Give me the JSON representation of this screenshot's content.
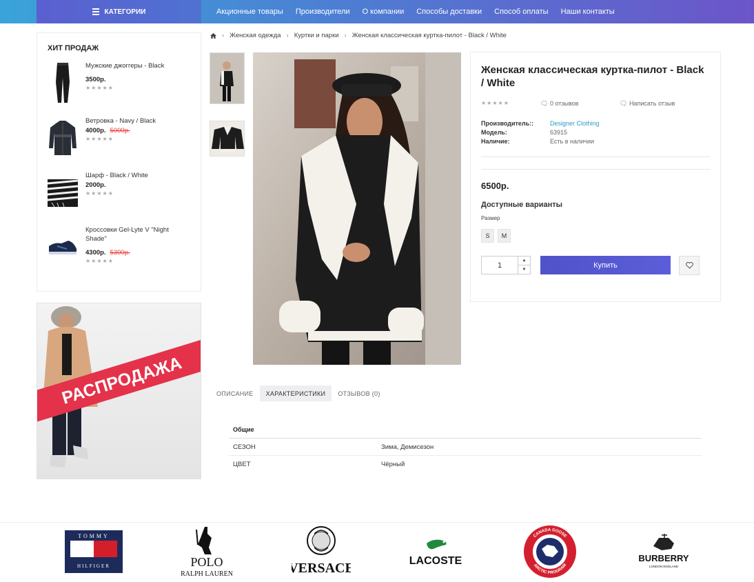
{
  "header": {
    "categories_label": "КАТЕГОРИИ",
    "menu": [
      "Акционные товары",
      "Производители",
      "О компании",
      "Способы доставки",
      "Способ оплаты",
      "Наши контакты"
    ]
  },
  "sidebar": {
    "hits_title": "ХИТ ПРОДАЖ",
    "items": [
      {
        "name": "Мужские джоггеры - Black",
        "price": "3500р.",
        "old_price": ""
      },
      {
        "name": "Ветровка - Navy / Black",
        "price": "4000р.",
        "old_price": "5000р."
      },
      {
        "name": "Шарф - Black / White",
        "price": "2000р.",
        "old_price": ""
      },
      {
        "name": "Кроссовки Gel-Lyte V \"Night Shade\"",
        "price": "4300р.",
        "old_price": "5300р."
      }
    ],
    "sale_banner_text": "РАСПРОДАЖА"
  },
  "breadcrumb": [
    "Женская одежда",
    "Куртки и парки",
    "Женская классическая куртка-пилот - Black / White"
  ],
  "product": {
    "title": "Женская классическая куртка-пилот - Black / White",
    "reviews_link": "0 отзывов",
    "write_review": "Написать отзыв",
    "manufacturer_label": "Производитель::",
    "manufacturer": "Designer Clothing",
    "model_label": "Модель:",
    "model": "63915",
    "availability_label": "Наличие:",
    "availability": "Есть в наличии",
    "price": "6500р.",
    "variants_title": "Доступные варианты",
    "size_label": "Размер",
    "sizes": [
      "S",
      "M"
    ],
    "quantity": "1",
    "buy_label": "Купить"
  },
  "tabs": [
    "ОПИСАНИЕ",
    "ХАРАКТЕРИСТИКИ",
    "ОТЗЫВОВ (0)"
  ],
  "attributes": {
    "group": "Общие",
    "rows": [
      {
        "name": "СЕЗОН",
        "value": "Зима, Демисезон"
      },
      {
        "name": "ЦВЕТ",
        "value": "Чёрный"
      }
    ]
  },
  "brands": {
    "tommy_line1": "TOMMY",
    "tommy_line2": "HILFIGER",
    "polo_line1": "POLO",
    "polo_line2": "RALPH LAUREN",
    "versace": "VERSACE",
    "lacoste": "LACOSTE",
    "canada_goose_ring_top": "CANADA GOOSE",
    "canada_goose_ring_bottom": "ARCTIC PROGRAM",
    "burberry": "BURBERRY",
    "burberry_sub": "LONDON ENGLAND"
  },
  "colors": {
    "nav_start": "#3aa4d9",
    "nav_end": "#6c55c9",
    "buy_button": "#5355cf",
    "link": "#2a9ac8",
    "old_price": "#ee3333",
    "sale_red": "#e3324a"
  }
}
